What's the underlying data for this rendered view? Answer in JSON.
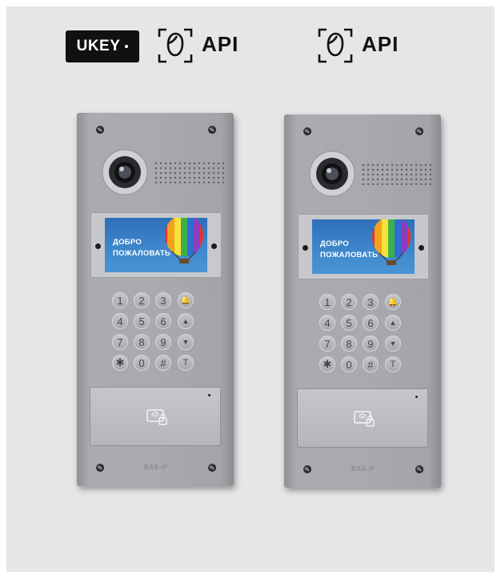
{
  "header": {
    "ukey_label": "UKEY",
    "api_label_1": "API",
    "api_label_2": "API",
    "face_icon": "face-recognition-icon"
  },
  "panels": [
    {
      "screen_line1": "ДОБРО",
      "screen_line2": "ПОЖАЛОВАТЬ",
      "keys": [
        "1",
        "2",
        "3",
        "🔔",
        "4",
        "5",
        "6",
        "▲",
        "7",
        "8",
        "9",
        "▼",
        "✱",
        "0",
        "#",
        "T"
      ],
      "reader_icon": "card-reader-icon",
      "logo": "BAS-IP"
    },
    {
      "screen_line1": "ДОБРО",
      "screen_line2": "ПОЖАЛОВАТЬ",
      "keys": [
        "1",
        "2",
        "3",
        "🔔",
        "4",
        "5",
        "6",
        "▲",
        "7",
        "8",
        "9",
        "▼",
        "✱",
        "0",
        "#",
        "T"
      ],
      "reader_icon": "card-reader-icon",
      "logo": "BAS-IP"
    }
  ],
  "colors": {
    "background": "#e6e6e7",
    "panel": "#a8aaae",
    "screen": "#3e86cb",
    "badge": "#111111"
  }
}
